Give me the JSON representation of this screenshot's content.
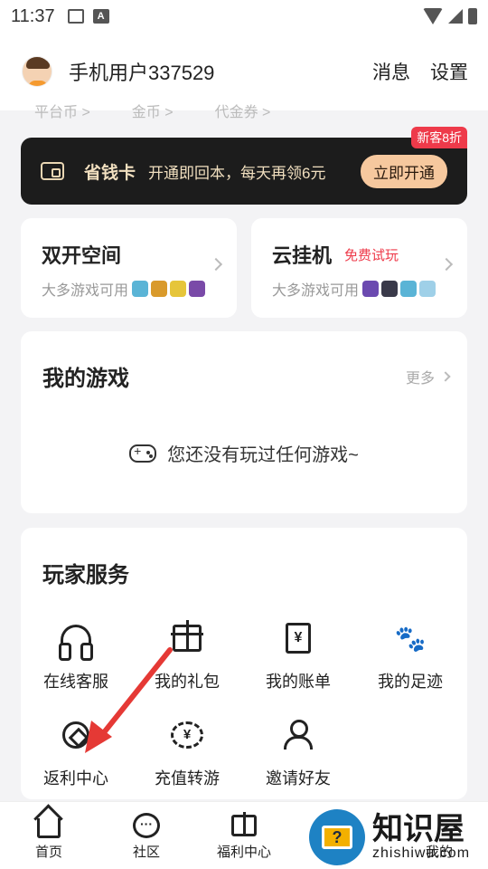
{
  "status_bar": {
    "time": "11:37"
  },
  "header": {
    "username": "手机用户337529",
    "messages": "消息",
    "settings": "设置"
  },
  "subtabs": [
    "平台币 >",
    "金币 >",
    "代金券 >"
  ],
  "vip": {
    "title": "省钱卡",
    "description": "开通即回本，每天再领6元",
    "button": "立即开通",
    "badge": "新客8折"
  },
  "dual_space": {
    "title": "双开空间",
    "subtitle": "大多游戏可用"
  },
  "cloud": {
    "title": "云挂机",
    "tag": "免费试玩",
    "subtitle": "大多游戏可用"
  },
  "my_games": {
    "title": "我的游戏",
    "more": "更多",
    "empty": "您还没有玩过任何游戏~"
  },
  "services": {
    "title": "玩家服务",
    "items": [
      {
        "label": "在线客服",
        "icon": "headset-icon"
      },
      {
        "label": "我的礼包",
        "icon": "gift-icon"
      },
      {
        "label": "我的账单",
        "icon": "bill-icon"
      },
      {
        "label": "我的足迹",
        "icon": "footprint-icon"
      },
      {
        "label": "返利中心",
        "icon": "rebate-icon"
      },
      {
        "label": "充值转游",
        "icon": "recharge-transfer-icon"
      },
      {
        "label": "邀请好友",
        "icon": "invite-friends-icon"
      }
    ]
  },
  "bottom_nav": [
    {
      "label": "首页",
      "icon": "home-icon"
    },
    {
      "label": "社区",
      "icon": "community-icon"
    },
    {
      "label": "福利中心",
      "icon": "gift-icon"
    },
    {
      "label": "",
      "icon": "covered"
    },
    {
      "label": "我的",
      "icon": "profile-icon"
    }
  ],
  "watermark": {
    "cn": "知识屋",
    "en": "zhishiwu.com"
  },
  "colors": {
    "accent_red": "#ee3a4a",
    "vip_gold": "#f1dfbf",
    "vip_button": "#f6c89e",
    "arrow": "#e53935"
  }
}
